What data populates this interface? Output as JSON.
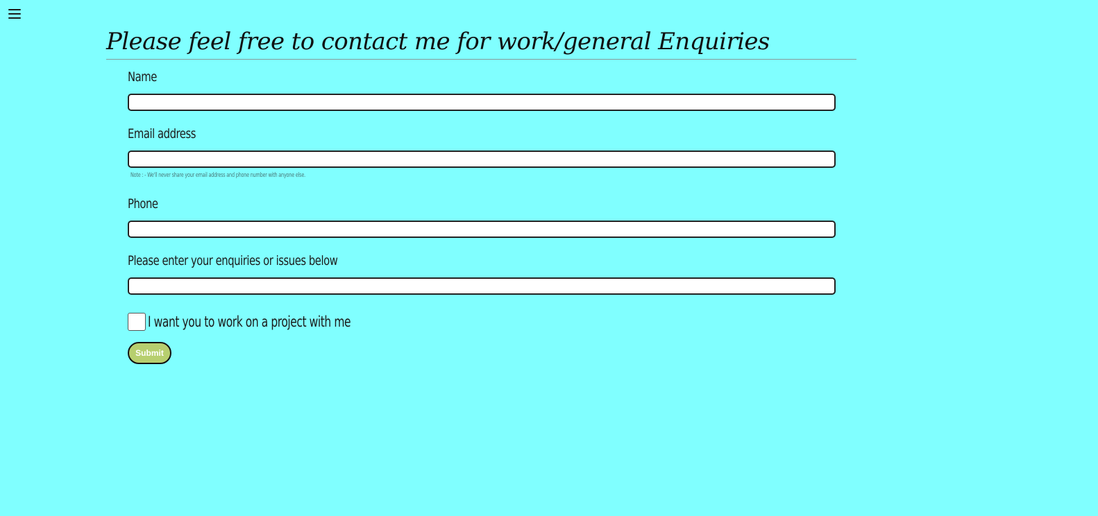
{
  "header": {
    "menu_icon": "hamburger-menu-icon",
    "title": "Please feel free to contact me for work/general Enquiries"
  },
  "form": {
    "name_label": "Name",
    "name_value": "",
    "email_label": "Email address",
    "email_value": "",
    "email_note": "Note : - We'll never share your email address and phone number with anyone else.",
    "phone_label": "Phone",
    "phone_value": "",
    "enquiry_label": "Please enter your enquiries or issues below",
    "enquiry_value": "",
    "project_checkbox_label": "I want you to work on a project with me",
    "project_checkbox_checked": false,
    "submit_label": "Submit"
  },
  "colors": {
    "page_background": "#80ffff",
    "submit_button": "#b7cf6f"
  }
}
